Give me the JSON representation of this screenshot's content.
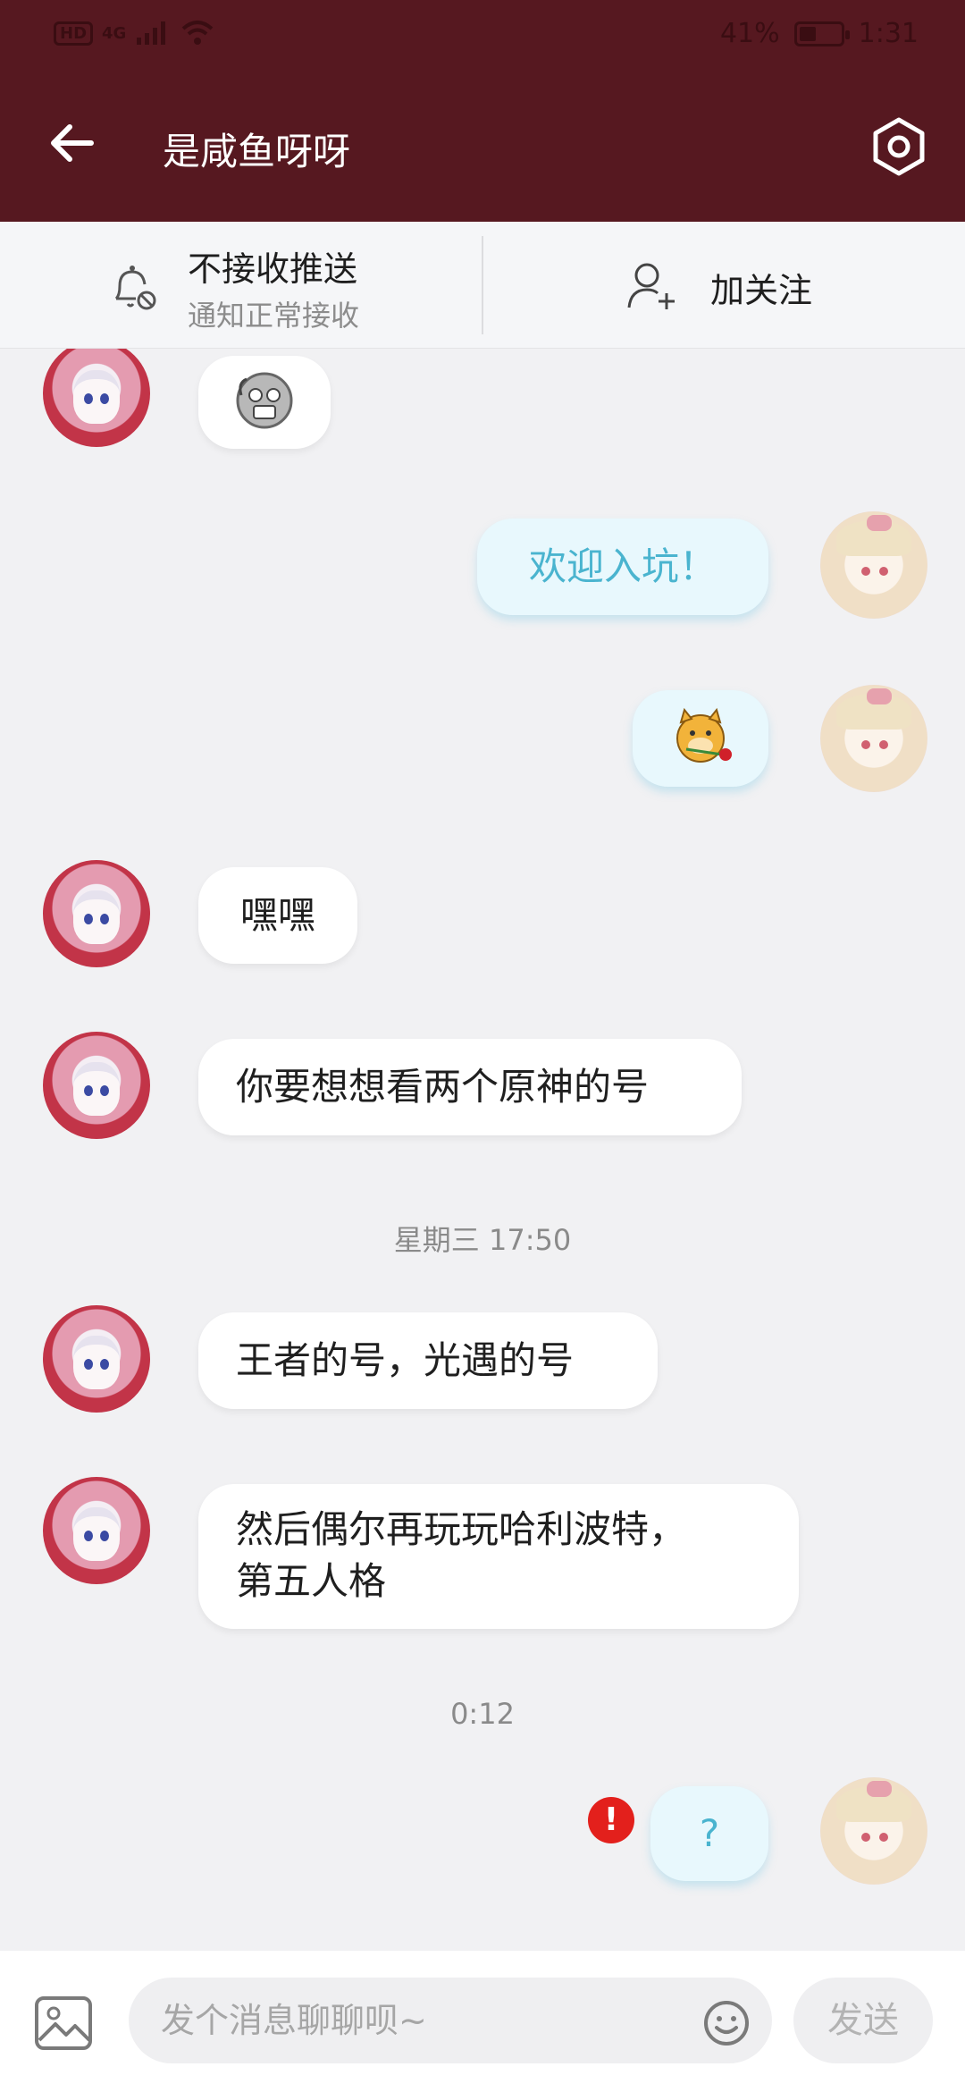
{
  "status_bar": {
    "hd": "HD",
    "network": "4G",
    "battery_percent": "41%",
    "battery_level": 0.41,
    "time": "1:31"
  },
  "header": {
    "title": "是咸鱼呀呀",
    "back_icon": "arrow-left-icon",
    "settings_icon": "hexagon-gear-icon"
  },
  "actions": {
    "notify": {
      "title": "不接收推送",
      "subtitle": "通知正常接收",
      "icon": "bell-off-icon"
    },
    "follow": {
      "label": "加关注",
      "icon": "add-user-icon"
    }
  },
  "messages": [
    {
      "side": "left",
      "type": "emoji",
      "emoji": "mask-face-emoji"
    },
    {
      "side": "right",
      "type": "text",
      "text": "欢迎入坑！"
    },
    {
      "side": "right",
      "type": "emoji",
      "emoji": "doge-with-rose-emoji"
    },
    {
      "side": "left",
      "type": "text",
      "text": "嘿嘿"
    },
    {
      "side": "left",
      "type": "text",
      "text": "你要想想看两个原神的号"
    },
    {
      "type": "time",
      "text": "星期三 17:50"
    },
    {
      "side": "left",
      "type": "text",
      "text": "王者的号，光遇的号"
    },
    {
      "side": "left",
      "type": "text",
      "text": "然后偶尔再玩玩哈利波特，",
      "text2": "第五人格"
    },
    {
      "type": "time",
      "text": "0:12"
    },
    {
      "side": "right",
      "type": "text",
      "text": "?",
      "failed": true,
      "error_mark": "!"
    }
  ],
  "composer": {
    "placeholder": "发个消息聊聊呗~",
    "send_label": "发送",
    "image_icon": "image-icon",
    "emoji_icon": "smiley-icon"
  },
  "colors": {
    "header_bg": "#561820",
    "bubble_mine_text": "#4ab4cf",
    "bubble_mine_bg": "#e8f8fd",
    "error_badge": "#e3201c"
  }
}
